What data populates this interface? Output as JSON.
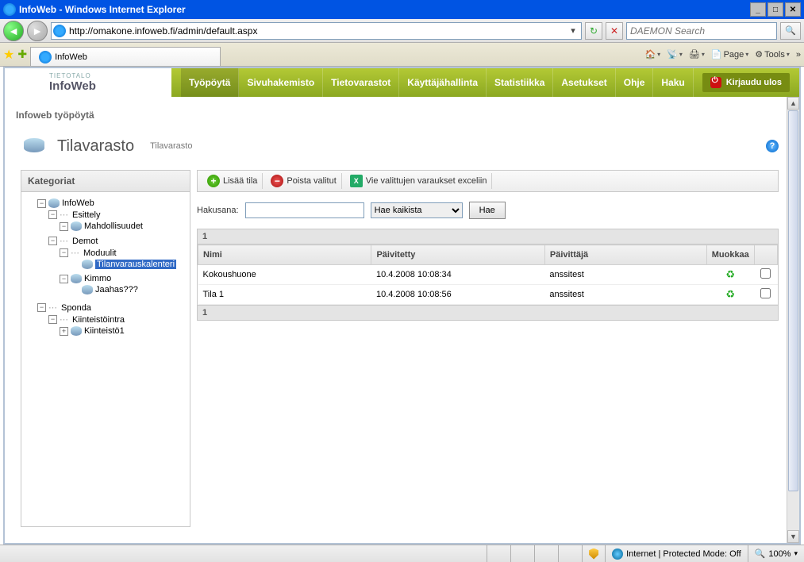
{
  "window": {
    "title": "InfoWeb - Windows Internet Explorer"
  },
  "address": {
    "url": "http://omakone.infoweb.fi/admin/default.aspx",
    "search_placeholder": "DAEMON Search"
  },
  "browser_tabs": {
    "active": "InfoWeb",
    "tools_page": "Page",
    "tools_tools": "Tools"
  },
  "logo": {
    "small": "TIETOTALO",
    "big": "InfoWeb"
  },
  "menu": {
    "items": [
      "Työpöytä",
      "Sivuhakemisto",
      "Tietovarastot",
      "Käyttäjähallinta",
      "Statistiikka",
      "Asetukset",
      "Ohje",
      "Haku"
    ],
    "logout": "Kirjaudu ulos"
  },
  "page": {
    "header": "Infoweb työpöytä",
    "title": "Tilavarasto",
    "subtitle": "Tilavarasto"
  },
  "sidebar": {
    "title": "Kategoriat",
    "root1": "InfoWeb",
    "node_esittely": "Esittely",
    "node_mahd": "Mahdollisuudet",
    "node_demot": "Demot",
    "node_moduulit": "Moduulit",
    "node_tilan": "Tilanvarauskalenteri",
    "node_kimmo": "Kimmo",
    "node_jaahas": "Jaahas???",
    "root2": "Sponda",
    "node_kiintra": "Kiinteistöintra",
    "node_kiint1": "Kiinteistö1"
  },
  "toolbar": {
    "add": "Lisää tila",
    "remove": "Poista valitut",
    "excel": "Vie valittujen varaukset exceliin"
  },
  "search": {
    "label": "Hakusana:",
    "scope_selected": "Hae kaikista",
    "button": "Hae"
  },
  "grid": {
    "page": "1",
    "cols": {
      "name": "Nimi",
      "updated": "Päivitetty",
      "updater": "Päivittäjä",
      "edit": "Muokkaa"
    },
    "rows": [
      {
        "name": "Kokoushuone",
        "updated": "10.4.2008 10:08:34",
        "updater": "anssitest"
      },
      {
        "name": "Tila 1",
        "updated": "10.4.2008 10:08:56",
        "updater": "anssitest"
      }
    ]
  },
  "status": {
    "zone": "Internet | Protected Mode: Off",
    "zoom": "100%"
  }
}
